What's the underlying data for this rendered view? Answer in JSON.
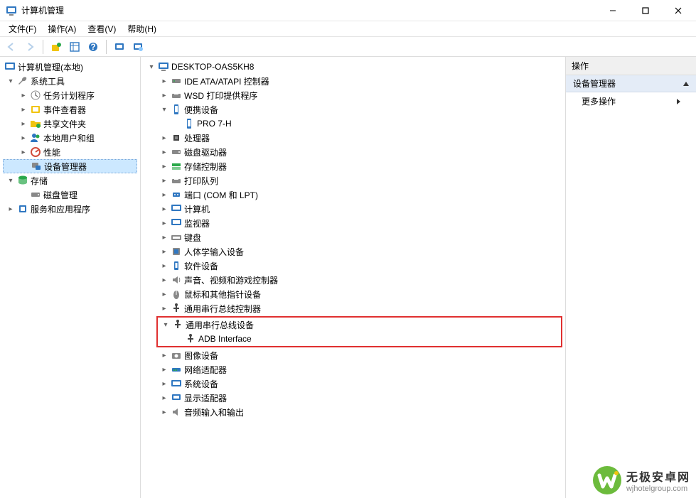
{
  "window": {
    "title": "计算机管理"
  },
  "menu": {
    "file": "文件(F)",
    "action": "操作(A)",
    "view": "查看(V)",
    "help": "帮助(H)"
  },
  "leftTree": {
    "root": "计算机管理(本地)",
    "systemTools": "系统工具",
    "taskScheduler": "任务计划程序",
    "eventViewer": "事件查看器",
    "sharedFolders": "共享文件夹",
    "localUsers": "本地用户和组",
    "performance": "性能",
    "deviceManager": "设备管理器",
    "storage": "存储",
    "diskManagement": "磁盘管理",
    "servicesApps": "服务和应用程序"
  },
  "devTree": {
    "root": "DESKTOP-OAS5KH8",
    "ide": "IDE ATA/ATAPI 控制器",
    "wsd": "WSD 打印提供程序",
    "portable": "便携设备",
    "pro7h": "PRO 7-H",
    "processors": "处理器",
    "diskDrives": "磁盘驱动器",
    "storageCtrl": "存储控制器",
    "printQueues": "打印队列",
    "ports": "端口 (COM 和 LPT)",
    "computers": "计算机",
    "monitors": "监视器",
    "keyboards": "键盘",
    "hid": "人体学输入设备",
    "software": "软件设备",
    "sound": "声音、视频和游戏控制器",
    "mice": "鼠标和其他指针设备",
    "usbCtrl": "通用串行总线控制器",
    "usbDevices": "通用串行总线设备",
    "adb": "ADB Interface",
    "imaging": "图像设备",
    "network": "网络适配器",
    "system": "系统设备",
    "display": "显示适配器",
    "audio": "音频输入和输出"
  },
  "rightPane": {
    "header": "操作",
    "section": "设备管理器",
    "more": "更多操作"
  },
  "watermark": {
    "name": "无极安卓网",
    "url": "wjhotelgroup.com"
  }
}
